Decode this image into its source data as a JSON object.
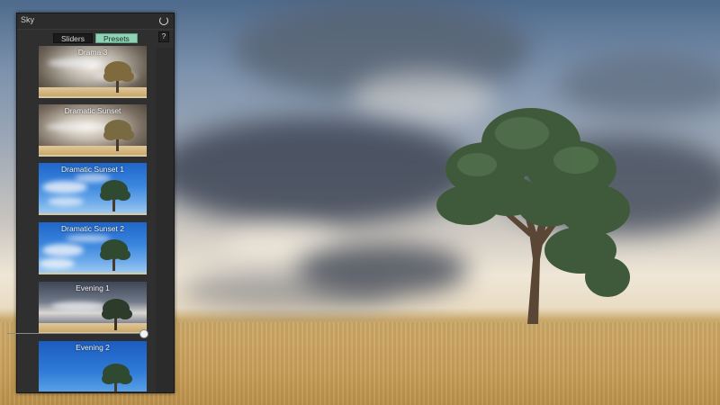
{
  "panel": {
    "title": "Sky",
    "tabs": [
      {
        "label": "Sliders",
        "active": false
      },
      {
        "label": "Presets",
        "active": true
      }
    ],
    "help_label": "?"
  },
  "presets": [
    {
      "label": "Drama 3",
      "style": "drama"
    },
    {
      "label": "Dramatic Sunset",
      "style": "sunset"
    },
    {
      "label": "Dramatic Sunset 1",
      "style": "blue"
    },
    {
      "label": "Dramatic Sunset 2",
      "style": "blue"
    },
    {
      "label": "Evening 1",
      "style": "evening"
    },
    {
      "label": "Evening 2",
      "style": "blue2"
    }
  ],
  "colors": {
    "active_tab": "#8fd2b6",
    "panel_bg": "#2f2f2f"
  },
  "icons": {
    "reset": "reset-icon",
    "help": "help-icon"
  }
}
